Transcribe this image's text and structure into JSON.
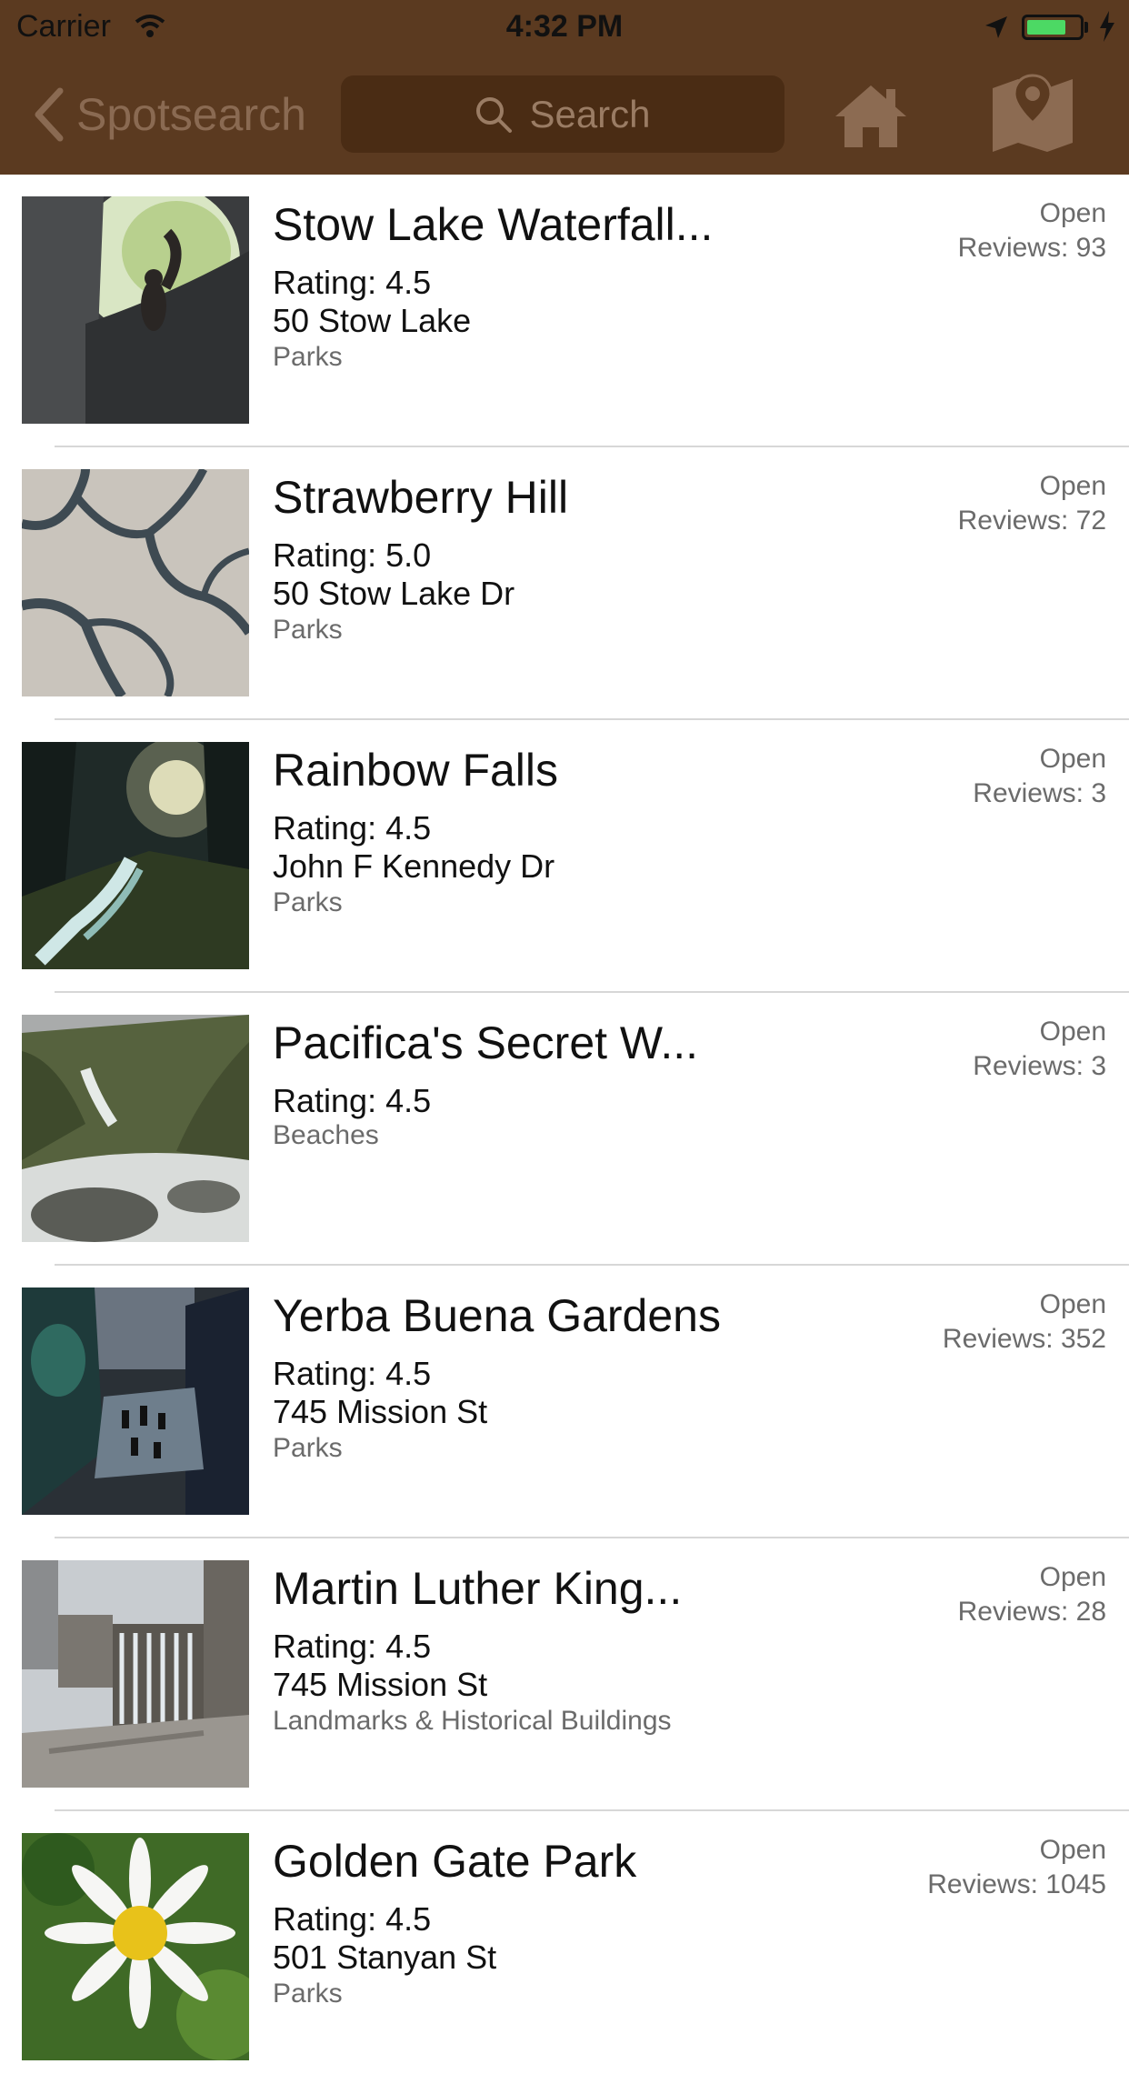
{
  "status_bar": {
    "carrier": "Carrier",
    "time": "4:32 PM",
    "battery_color": "#4cd964"
  },
  "nav": {
    "back_label": "Spotsearch",
    "search_placeholder": "Search",
    "home_icon": "home-icon",
    "map_icon": "map-pin-icon",
    "bar_color": "#5b3a20"
  },
  "places": [
    {
      "name": "Stow Lake Waterfall...",
      "rating": "Rating: 4.5",
      "address": "50 Stow Lake",
      "category": "Parks",
      "status": "Open",
      "reviews": "Reviews: 93"
    },
    {
      "name": "Strawberry Hill",
      "rating": "Rating: 5.0",
      "address": "50 Stow Lake Dr",
      "category": "Parks",
      "status": "Open",
      "reviews": "Reviews: 72"
    },
    {
      "name": "Rainbow Falls",
      "rating": "Rating: 4.5",
      "address": "John F Kennedy Dr",
      "category": "Parks",
      "status": "Open",
      "reviews": "Reviews: 3"
    },
    {
      "name": "Pacifica's Secret W...",
      "rating": "Rating: 4.5",
      "address": "",
      "category": "Beaches",
      "status": "Open",
      "reviews": "Reviews: 3"
    },
    {
      "name": "Yerba Buena Gardens",
      "rating": "Rating: 4.5",
      "address": "745 Mission St",
      "category": "Parks",
      "status": "Open",
      "reviews": "Reviews: 352"
    },
    {
      "name": "Martin Luther King...",
      "rating": "Rating: 4.5",
      "address": "745 Mission St",
      "category": "Landmarks & Historical Buildings",
      "status": "Open",
      "reviews": "Reviews: 28"
    },
    {
      "name": "Golden Gate Park",
      "rating": "Rating: 4.5",
      "address": "501 Stanyan St",
      "category": "Parks",
      "status": "Open",
      "reviews": "Reviews: 1045"
    }
  ]
}
